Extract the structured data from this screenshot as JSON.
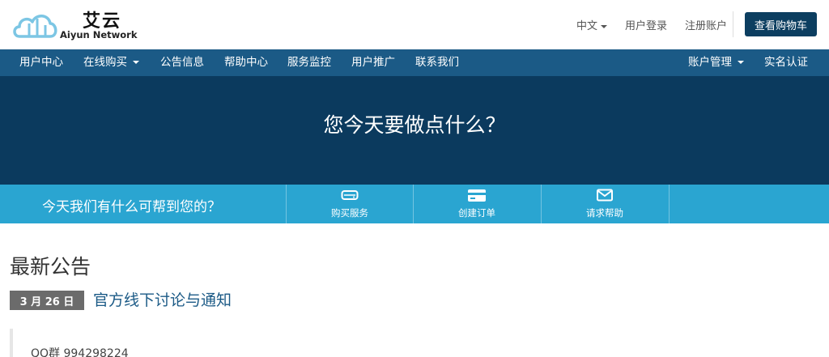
{
  "header": {
    "logo_title": "艾云",
    "logo_subtitle": "Aiyun Network",
    "language_label": "中文",
    "login_label": "用户登录",
    "register_label": "注册账户",
    "cart_button": "查看购物车"
  },
  "nav": {
    "items": [
      {
        "label": "用户中心"
      },
      {
        "label": "在线购买"
      },
      {
        "label": "公告信息"
      },
      {
        "label": "帮助中心"
      },
      {
        "label": "服务监控"
      },
      {
        "label": "用户推广"
      },
      {
        "label": "联系我们"
      }
    ],
    "right_items": [
      {
        "label": "账户管理"
      },
      {
        "label": "实名认证"
      }
    ]
  },
  "hero": {
    "title": "您今天要做点什么？"
  },
  "actionbar": {
    "help_text": "今天我们有什么可帮到您的？",
    "actions": [
      {
        "label": "购买服务",
        "icon": "server-icon"
      },
      {
        "label": "创建订单",
        "icon": "credit-card-icon"
      },
      {
        "label": "请求帮助",
        "icon": "envelope-icon"
      }
    ]
  },
  "announcements": {
    "title": "最新公告",
    "items": [
      {
        "date": "3 月 26 日",
        "title": "官方线下讨论与通知",
        "excerpt": "QQ群 994298224"
      }
    ]
  },
  "colors": {
    "nav_bg": "#1b5a86",
    "hero_bg": "#0b3a5e",
    "action_bg": "#2aa5d1",
    "cart_bg": "#0c3e60",
    "link": "#1b5a86"
  }
}
